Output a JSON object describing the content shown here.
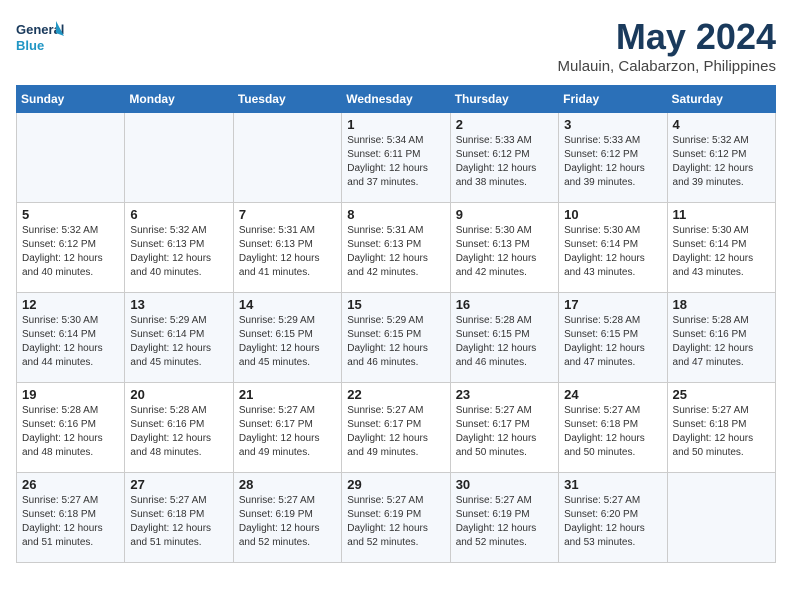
{
  "header": {
    "logo_line1": "General",
    "logo_line2": "Blue",
    "month_title": "May 2024",
    "location": "Mulauin, Calabarzon, Philippines"
  },
  "weekdays": [
    "Sunday",
    "Monday",
    "Tuesday",
    "Wednesday",
    "Thursday",
    "Friday",
    "Saturday"
  ],
  "weeks": [
    [
      {
        "day": "",
        "sunrise": "",
        "sunset": "",
        "daylight": ""
      },
      {
        "day": "",
        "sunrise": "",
        "sunset": "",
        "daylight": ""
      },
      {
        "day": "",
        "sunrise": "",
        "sunset": "",
        "daylight": ""
      },
      {
        "day": "1",
        "sunrise": "Sunrise: 5:34 AM",
        "sunset": "Sunset: 6:11 PM",
        "daylight": "Daylight: 12 hours and 37 minutes."
      },
      {
        "day": "2",
        "sunrise": "Sunrise: 5:33 AM",
        "sunset": "Sunset: 6:12 PM",
        "daylight": "Daylight: 12 hours and 38 minutes."
      },
      {
        "day": "3",
        "sunrise": "Sunrise: 5:33 AM",
        "sunset": "Sunset: 6:12 PM",
        "daylight": "Daylight: 12 hours and 39 minutes."
      },
      {
        "day": "4",
        "sunrise": "Sunrise: 5:32 AM",
        "sunset": "Sunset: 6:12 PM",
        "daylight": "Daylight: 12 hours and 39 minutes."
      }
    ],
    [
      {
        "day": "5",
        "sunrise": "Sunrise: 5:32 AM",
        "sunset": "Sunset: 6:12 PM",
        "daylight": "Daylight: 12 hours and 40 minutes."
      },
      {
        "day": "6",
        "sunrise": "Sunrise: 5:32 AM",
        "sunset": "Sunset: 6:13 PM",
        "daylight": "Daylight: 12 hours and 40 minutes."
      },
      {
        "day": "7",
        "sunrise": "Sunrise: 5:31 AM",
        "sunset": "Sunset: 6:13 PM",
        "daylight": "Daylight: 12 hours and 41 minutes."
      },
      {
        "day": "8",
        "sunrise": "Sunrise: 5:31 AM",
        "sunset": "Sunset: 6:13 PM",
        "daylight": "Daylight: 12 hours and 42 minutes."
      },
      {
        "day": "9",
        "sunrise": "Sunrise: 5:30 AM",
        "sunset": "Sunset: 6:13 PM",
        "daylight": "Daylight: 12 hours and 42 minutes."
      },
      {
        "day": "10",
        "sunrise": "Sunrise: 5:30 AM",
        "sunset": "Sunset: 6:14 PM",
        "daylight": "Daylight: 12 hours and 43 minutes."
      },
      {
        "day": "11",
        "sunrise": "Sunrise: 5:30 AM",
        "sunset": "Sunset: 6:14 PM",
        "daylight": "Daylight: 12 hours and 43 minutes."
      }
    ],
    [
      {
        "day": "12",
        "sunrise": "Sunrise: 5:30 AM",
        "sunset": "Sunset: 6:14 PM",
        "daylight": "Daylight: 12 hours and 44 minutes."
      },
      {
        "day": "13",
        "sunrise": "Sunrise: 5:29 AM",
        "sunset": "Sunset: 6:14 PM",
        "daylight": "Daylight: 12 hours and 45 minutes."
      },
      {
        "day": "14",
        "sunrise": "Sunrise: 5:29 AM",
        "sunset": "Sunset: 6:15 PM",
        "daylight": "Daylight: 12 hours and 45 minutes."
      },
      {
        "day": "15",
        "sunrise": "Sunrise: 5:29 AM",
        "sunset": "Sunset: 6:15 PM",
        "daylight": "Daylight: 12 hours and 46 minutes."
      },
      {
        "day": "16",
        "sunrise": "Sunrise: 5:28 AM",
        "sunset": "Sunset: 6:15 PM",
        "daylight": "Daylight: 12 hours and 46 minutes."
      },
      {
        "day": "17",
        "sunrise": "Sunrise: 5:28 AM",
        "sunset": "Sunset: 6:15 PM",
        "daylight": "Daylight: 12 hours and 47 minutes."
      },
      {
        "day": "18",
        "sunrise": "Sunrise: 5:28 AM",
        "sunset": "Sunset: 6:16 PM",
        "daylight": "Daylight: 12 hours and 47 minutes."
      }
    ],
    [
      {
        "day": "19",
        "sunrise": "Sunrise: 5:28 AM",
        "sunset": "Sunset: 6:16 PM",
        "daylight": "Daylight: 12 hours and 48 minutes."
      },
      {
        "day": "20",
        "sunrise": "Sunrise: 5:28 AM",
        "sunset": "Sunset: 6:16 PM",
        "daylight": "Daylight: 12 hours and 48 minutes."
      },
      {
        "day": "21",
        "sunrise": "Sunrise: 5:27 AM",
        "sunset": "Sunset: 6:17 PM",
        "daylight": "Daylight: 12 hours and 49 minutes."
      },
      {
        "day": "22",
        "sunrise": "Sunrise: 5:27 AM",
        "sunset": "Sunset: 6:17 PM",
        "daylight": "Daylight: 12 hours and 49 minutes."
      },
      {
        "day": "23",
        "sunrise": "Sunrise: 5:27 AM",
        "sunset": "Sunset: 6:17 PM",
        "daylight": "Daylight: 12 hours and 50 minutes."
      },
      {
        "day": "24",
        "sunrise": "Sunrise: 5:27 AM",
        "sunset": "Sunset: 6:18 PM",
        "daylight": "Daylight: 12 hours and 50 minutes."
      },
      {
        "day": "25",
        "sunrise": "Sunrise: 5:27 AM",
        "sunset": "Sunset: 6:18 PM",
        "daylight": "Daylight: 12 hours and 50 minutes."
      }
    ],
    [
      {
        "day": "26",
        "sunrise": "Sunrise: 5:27 AM",
        "sunset": "Sunset: 6:18 PM",
        "daylight": "Daylight: 12 hours and 51 minutes."
      },
      {
        "day": "27",
        "sunrise": "Sunrise: 5:27 AM",
        "sunset": "Sunset: 6:18 PM",
        "daylight": "Daylight: 12 hours and 51 minutes."
      },
      {
        "day": "28",
        "sunrise": "Sunrise: 5:27 AM",
        "sunset": "Sunset: 6:19 PM",
        "daylight": "Daylight: 12 hours and 52 minutes."
      },
      {
        "day": "29",
        "sunrise": "Sunrise: 5:27 AM",
        "sunset": "Sunset: 6:19 PM",
        "daylight": "Daylight: 12 hours and 52 minutes."
      },
      {
        "day": "30",
        "sunrise": "Sunrise: 5:27 AM",
        "sunset": "Sunset: 6:19 PM",
        "daylight": "Daylight: 12 hours and 52 minutes."
      },
      {
        "day": "31",
        "sunrise": "Sunrise: 5:27 AM",
        "sunset": "Sunset: 6:20 PM",
        "daylight": "Daylight: 12 hours and 53 minutes."
      },
      {
        "day": "",
        "sunrise": "",
        "sunset": "",
        "daylight": ""
      }
    ]
  ]
}
